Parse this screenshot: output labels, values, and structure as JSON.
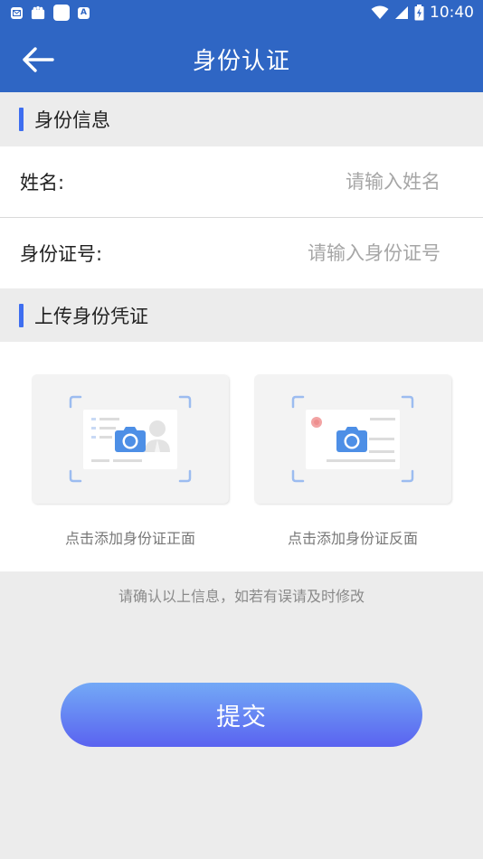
{
  "status_bar": {
    "time": "10:40",
    "icons": [
      "mail-icon",
      "notification-icon",
      "app-icon",
      "a-icon",
      "wifi-icon",
      "signal-icon",
      "battery-icon"
    ]
  },
  "header": {
    "title": "身份认证",
    "back_icon": "arrow-left-icon"
  },
  "identity_section": {
    "title": "身份信息",
    "name_label": "姓名:",
    "name_placeholder": "请输入姓名",
    "id_label": "身份证号:",
    "id_placeholder": "请输入身份证号"
  },
  "upload_section": {
    "title": "上传身份凭证",
    "front_caption": "点击添加身份证正面",
    "back_caption": "点击添加身份证反面"
  },
  "notice": "请确认以上信息，如若有误请及时修改",
  "submit_label": "提交",
  "colors": {
    "primary": "#2f66c4",
    "accent": "#3e6ef0",
    "camera": "#4d8fe6",
    "button_top": "#73a9f6",
    "button_bottom": "#5a63f0"
  }
}
